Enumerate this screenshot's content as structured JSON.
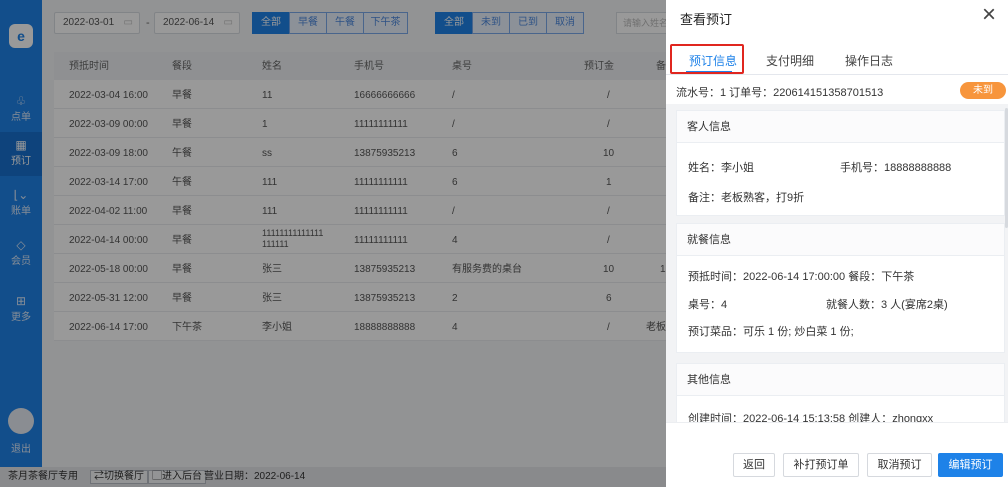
{
  "sidebar": {
    "logo": "e",
    "items": [
      {
        "icon": "♧",
        "label": "点单"
      },
      {
        "icon": "▦",
        "label": "预订"
      },
      {
        "icon": "⌊⌄",
        "label": "账单"
      },
      {
        "icon": "◇",
        "label": "会员"
      },
      {
        "icon": "⊞",
        "label": "更多"
      }
    ],
    "exit_label": "退出"
  },
  "filters": {
    "date_from": "2022-03-01",
    "date_sep": "-",
    "date_to": "2022-06-14",
    "meal_tabs": [
      "全部",
      "早餐",
      "午餐",
      "下午茶"
    ],
    "status_tabs": [
      "全部",
      "未到",
      "已到",
      "取消"
    ],
    "search_placeholder": "请输入姓名"
  },
  "table": {
    "headers": [
      "预抵时间",
      "餐段",
      "姓名",
      "手机号",
      "桌号",
      "预订金",
      "备"
    ],
    "rows": [
      [
        "2022-03-04 16:00",
        "早餐",
        "11",
        "16666666666",
        "/",
        "/",
        ""
      ],
      [
        "2022-03-09 00:00",
        "早餐",
        "1",
        "11111111111",
        "/",
        "/",
        ""
      ],
      [
        "2022-03-09 18:00",
        "午餐",
        "ss",
        "13875935213",
        "6",
        "10",
        ""
      ],
      [
        "2022-03-14 17:00",
        "午餐",
        "111",
        "11111111111",
        "6",
        "1",
        ""
      ],
      [
        "2022-04-02 11:00",
        "早餐",
        "111",
        "11111111111",
        "/",
        "/",
        ""
      ],
      [
        "2022-04-14 00:00",
        "早餐",
        "11111111111111 111111",
        "11111111111",
        "4",
        "/",
        ""
      ],
      [
        "2022-05-18 00:00",
        "早餐",
        "张三",
        "13875935213",
        "有服务费的桌台",
        "10",
        "1"
      ],
      [
        "2022-05-31 12:00",
        "早餐",
        "张三",
        "13875935213",
        "2",
        "6",
        ""
      ],
      [
        "2022-06-14 17:00",
        "下午茶",
        "李小姐",
        "18888888888",
        "4",
        "/",
        "老板"
      ]
    ]
  },
  "statusbar": {
    "store": "茶月茶餐厅专用",
    "switch_btn": "⇄切换餐厅",
    "backend_btn": "▢进入后台",
    "business_date": "营业日期：2022-06-14"
  },
  "drawer": {
    "title": "查看预订",
    "tabs": [
      "预订信息",
      "支付明细",
      "操作日志"
    ],
    "serial": "流水号：1  订单号：220614151358701513",
    "status_badge": "未到",
    "guest": {
      "title": "客人信息",
      "name": "姓名：李小姐",
      "phone": "手机号：18888888888",
      "note": "备注：老板熟客，打9折"
    },
    "dining": {
      "title": "就餐信息",
      "arrival": "预抵时间：2022-06-14 17:00:00 餐段：下午茶",
      "table": "桌号：4",
      "guests": "就餐人数：3 人(宴席2桌)",
      "dishes": "预订菜品：可乐 1 份; 炒白菜 1 份;"
    },
    "other": {
      "title": "其他信息",
      "created": "创建时间：2022-06-14 15:13:58 创建人：zhongxx"
    },
    "buttons": [
      "返回",
      "补打预订单",
      "取消预订",
      "编辑预订"
    ]
  }
}
